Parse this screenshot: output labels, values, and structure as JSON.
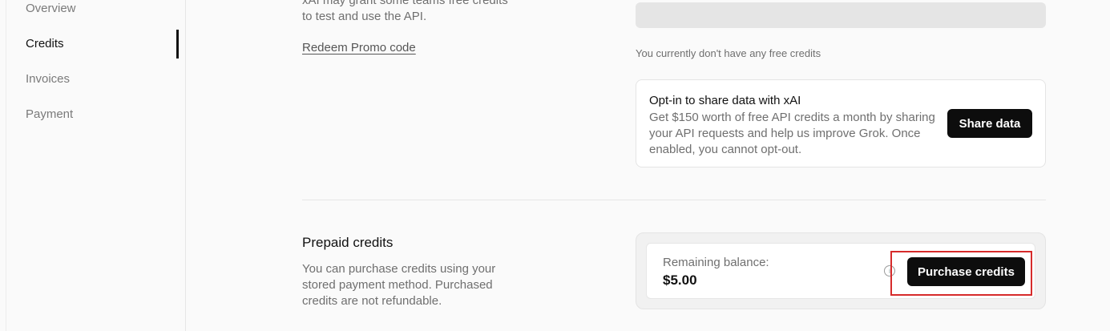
{
  "sidebar": {
    "items": [
      {
        "label": "Overview"
      },
      {
        "label": "Credits"
      },
      {
        "label": "Invoices"
      },
      {
        "label": "Payment"
      }
    ]
  },
  "free_credits": {
    "intro": "xAI may grant some teams free credits to test and use the API.",
    "redeem_label": "Redeem Promo code",
    "note": "You currently don't have any free credits"
  },
  "optin": {
    "title": "Opt-in to share data with xAI",
    "body": "Get $150 worth of free API credits a month by sharing your API requests and help us improve Grok. Once enabled, you cannot opt-out.",
    "button_label": "Share data"
  },
  "prepaid": {
    "title": "Prepaid credits",
    "description": "You can purchase credits using your stored payment method. Purchased credits are not refundable.",
    "balance_label": "Remaining balance:",
    "balance_value": "$5.00",
    "info_icon": "info-circle-icon",
    "button_label": "Purchase credits"
  },
  "colors": {
    "accent_dark": "#0d0d0d",
    "highlight": "#d62b2b"
  }
}
